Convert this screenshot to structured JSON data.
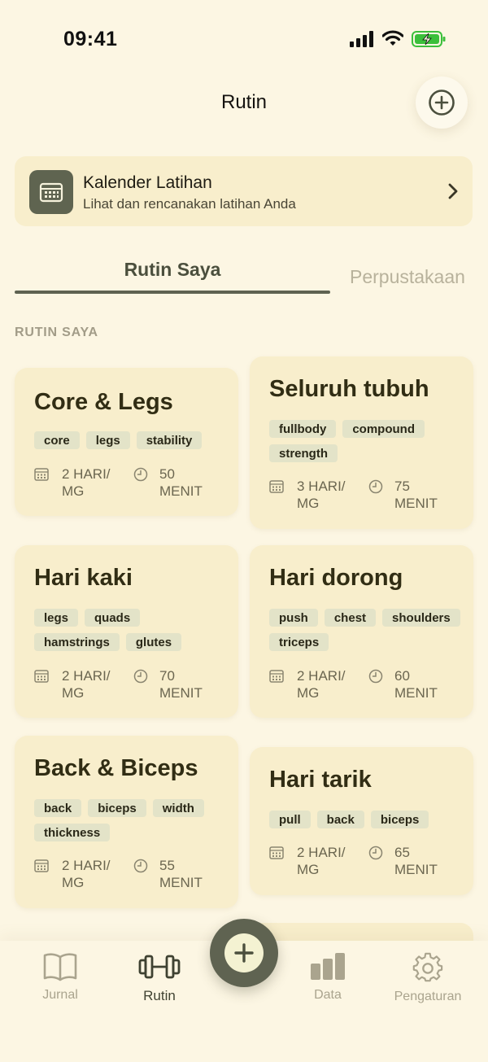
{
  "status_bar": {
    "time": "09:41"
  },
  "header": {
    "title": "Rutin"
  },
  "calendar_card": {
    "title": "Kalender Latihan",
    "subtitle": "Lihat dan rencanakan latihan Anda"
  },
  "tabs": [
    {
      "label": "Rutin Saya",
      "active": true
    },
    {
      "label": "Perpustakaan",
      "active": false
    }
  ],
  "section_label": "RUTIN SAYA",
  "routines": [
    {
      "title": "Core & Legs",
      "tags": [
        "core",
        "legs",
        "stability"
      ],
      "days_line1": "2 HARI/",
      "days_line2": "MG",
      "mins_line1": "50",
      "mins_line2": "MENIT"
    },
    {
      "title": "Seluruh tubuh",
      "tags": [
        "fullbody",
        "compound",
        "strength"
      ],
      "days_line1": "3 HARI/",
      "days_line2": "MG",
      "mins_line1": "75",
      "mins_line2": "MENIT"
    },
    {
      "title": "Hari kaki",
      "tags": [
        "legs",
        "quads",
        "hamstrings",
        "glutes"
      ],
      "days_line1": "2 HARI/",
      "days_line2": "MG",
      "mins_line1": "70",
      "mins_line2": "MENIT"
    },
    {
      "title": "Hari dorong",
      "tags": [
        "push",
        "chest",
        "shoulders",
        "triceps"
      ],
      "days_line1": "2 HARI/",
      "days_line2": "MG",
      "mins_line1": "60",
      "mins_line2": "MENIT"
    },
    {
      "title": "Back & Biceps",
      "tags": [
        "back",
        "biceps",
        "width",
        "thickness"
      ],
      "days_line1": "2 HARI/",
      "days_line2": "MG",
      "mins_line1": "55",
      "mins_line2": "MENIT"
    },
    {
      "title": "Hari tarik",
      "tags": [
        "pull",
        "back",
        "biceps"
      ],
      "days_line1": "2 HARI/",
      "days_line2": "MG",
      "mins_line1": "65",
      "mins_line2": "MENIT"
    }
  ],
  "bottom_nav": [
    {
      "label": "Jurnal",
      "icon": "book-icon",
      "active": false
    },
    {
      "label": "Rutin",
      "icon": "dumbbell-icon",
      "active": true
    },
    {
      "label": "Data",
      "icon": "bar-chart-icon",
      "active": false
    },
    {
      "label": "Pengaturan",
      "icon": "gear-icon",
      "active": false
    }
  ],
  "colors": {
    "background": "#fcf6e3",
    "card": "#f8eecc",
    "accent": "#5f6351",
    "tag": "#e3e3c8"
  }
}
